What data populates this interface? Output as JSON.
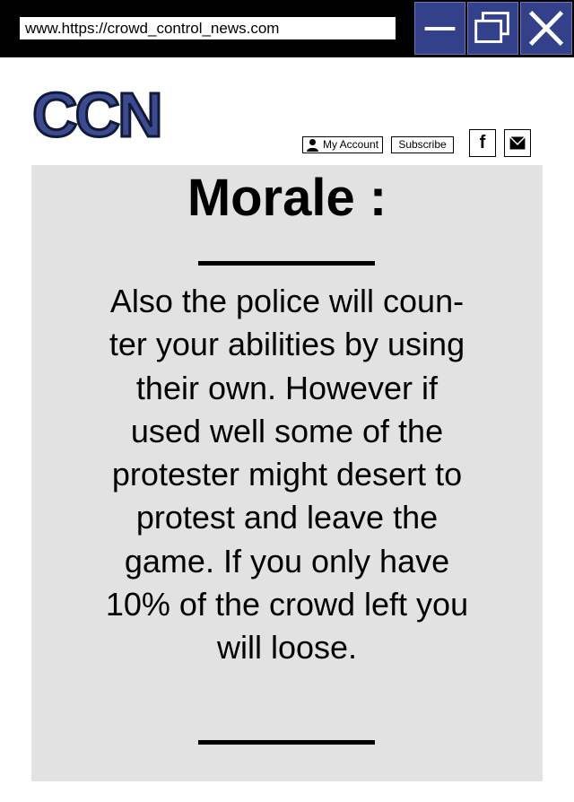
{
  "browser": {
    "url": "www.https://crowd_control_news.com",
    "buttons": {
      "minimize": "minimize-icon",
      "maximize": "restore-icon",
      "close": "close-icon"
    }
  },
  "site": {
    "logo": "CCN",
    "brand_color": "#3c4a8f",
    "account_label": "My Account",
    "subscribe_label": "Subscribe",
    "facebook_label": "f",
    "mail_icon": "mail-icon"
  },
  "article": {
    "headline": "Morale :",
    "body_lines": [
      "Also the police will coun-",
      "ter your abilities by using",
      "their own. However if",
      "used well some of the",
      "protester might desert to",
      "protest and leave the",
      "game. If you only have",
      "10% of the crowd left you",
      "will loose."
    ],
    "background": "#e2e2e2"
  }
}
